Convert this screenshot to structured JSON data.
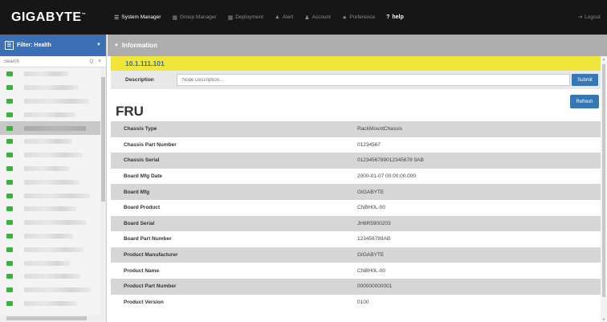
{
  "brand": {
    "logo": "GIGABYTE"
  },
  "nav": [
    {
      "label": "System Manager",
      "icon": "list-icon",
      "glyph": "☰",
      "active": true
    },
    {
      "label": "Group Manager",
      "icon": "grid-icon",
      "glyph": "▦",
      "active": false
    },
    {
      "label": "Deployment",
      "icon": "grid-icon",
      "glyph": "▦",
      "active": false
    },
    {
      "label": "Alert",
      "icon": "warning-icon",
      "glyph": "▲",
      "active": false
    },
    {
      "label": "Account",
      "icon": "user-icon",
      "glyph": "♟",
      "active": false
    },
    {
      "label": "Preference",
      "icon": "star-icon",
      "glyph": "★",
      "active": false
    },
    {
      "label": "help",
      "icon": "question-icon",
      "glyph": "?",
      "active": false
    }
  ],
  "logout": {
    "label": "Logout",
    "glyph": "⇥"
  },
  "sidebar": {
    "filter_label": "Filter:",
    "filter_value": "Health",
    "search_placeholder": "Search",
    "search_glyph": "Q ≡",
    "node_count": 19,
    "selected_index": 4
  },
  "main": {
    "section_title": "Information",
    "ip": "10.1.111.101",
    "description_label": "Description",
    "description_placeholder": "Node Description...",
    "submit_label": "Submit",
    "fru_title": "FRU",
    "refresh_label": "Refresh",
    "fru_rows": [
      {
        "key": "Chassis Type",
        "value": "RackMountChassis"
      },
      {
        "key": "Chassis Part Number",
        "value": "01234567"
      },
      {
        "key": "Chassis Serial",
        "value": "0123456789012345678 9AB"
      },
      {
        "key": "Board Mfg Date",
        "value": "2000-01-07 00:00:00.000"
      },
      {
        "key": "Board Mfg",
        "value": "GIGABYTE"
      },
      {
        "key": "Board Product",
        "value": "CNBH0L-00"
      },
      {
        "key": "Board Serial",
        "value": "JH6R5900203"
      },
      {
        "key": "Board Part Number",
        "value": "123456789AB"
      },
      {
        "key": "Product Manufacturer",
        "value": "GIGABYTE"
      },
      {
        "key": "Product Name",
        "value": "CNBH0L-00"
      },
      {
        "key": "Product Part Number",
        "value": "000000000001"
      },
      {
        "key": "Product Version",
        "value": "0100"
      }
    ]
  }
}
